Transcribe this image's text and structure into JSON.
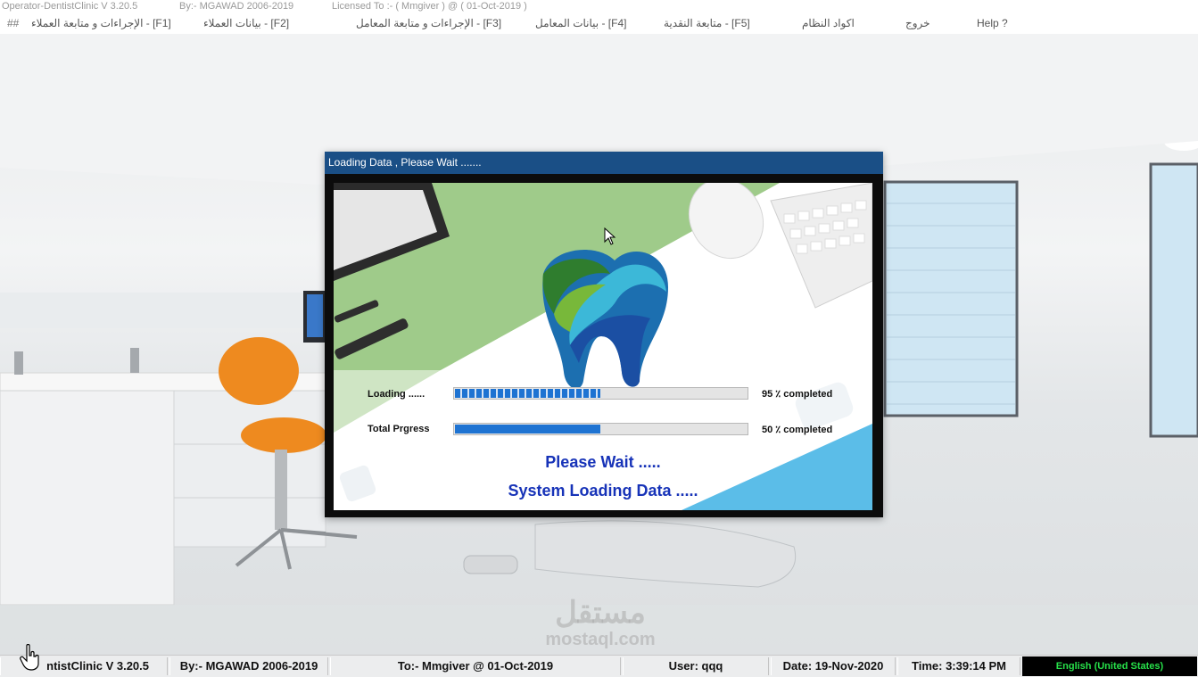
{
  "titlebar": {
    "app": "Operator-DentistClinic V 3.20.5",
    "by": "By:- MGAWAD 2006-2019",
    "license": "Licensed To :- ( Mmgiver ) @ ( 01-Oct-2019 )"
  },
  "menu": {
    "hash": "##",
    "items": [
      "[F1] - الإجراءات و متابعة العملاء",
      "[F2] - بيانات العملاء",
      "[F3] - الإجراءات و متابعة المعامل",
      "[F4] - بيانات المعامل",
      "[F5] - متابعة النقدية",
      "اكواد النظام",
      "خروج",
      "Help ?"
    ]
  },
  "dialog": {
    "title": "Loading Data , Please Wait .......",
    "loading_label": "Loading ......",
    "loading_percent": "95 ٪ completed",
    "loading_fraction": 0.5,
    "total_label": "Total Prgress",
    "total_percent": "50 ٪ completed",
    "total_fraction": 0.5,
    "please_wait": "Please Wait .....",
    "system_loading": "System Loading Data ....."
  },
  "status": {
    "app": "ntistClinic V 3.20.5",
    "by": "By:- MGAWAD 2006-2019",
    "to": "To:- Mmgiver @ 01-Oct-2019",
    "user": "User: qqq",
    "date": "Date: 19-Nov-2020",
    "time": "Time: 3:39:14 PM",
    "language": "English (United States)"
  },
  "watermark": {
    "arabic": "مستقل",
    "latin": "mostaql.com"
  },
  "colors": {
    "dialog_title": "#1a4f86",
    "progress": "#1e73d2",
    "headline": "#1733b8",
    "lang_text": "#27e04a"
  }
}
